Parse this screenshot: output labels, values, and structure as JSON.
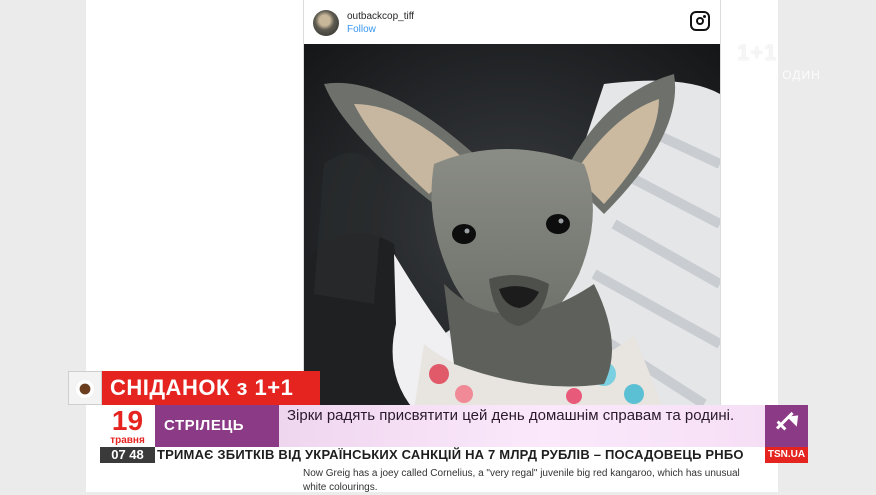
{
  "instagram": {
    "username": "outbackcop_tiff",
    "follow_label": "Follow",
    "logo_icon": "instagram-icon"
  },
  "photo": {
    "subject_icon": "joey-kangaroo-photo"
  },
  "watermark": {
    "logo": "1+1",
    "slogan": "ТИ НЕ ОДИН"
  },
  "article": {
    "text": "Now Greig has a joey called Cornelius, a \"very regal\" juvenile big red kangaroo, which has unusual white colourings."
  },
  "show": {
    "title": "СНІДАНОК з 1+1",
    "coffee_icon": "coffee-cup-icon"
  },
  "date": {
    "day": "19",
    "month": "травня"
  },
  "horoscope": {
    "sign": "СТРІЛЕЦЬ",
    "text": "Зірки радять присвятити цей день домашнім справам та родині.",
    "zodiac_icon": "sagittarius-icon"
  },
  "ticker": {
    "time": "07 48",
    "text": "ТРИМАЄ ЗБИТКІВ ВІД УКРАЇНСЬКИХ САНКЦІЙ НА 7 МЛРД РУБЛІВ – ПОСАДОВЕЦЬ РНБО",
    "source": "TSN.UA"
  },
  "colors": {
    "brand_red": "#e52420",
    "purple": "#8b3a86",
    "instagram_link": "#3897f0"
  }
}
